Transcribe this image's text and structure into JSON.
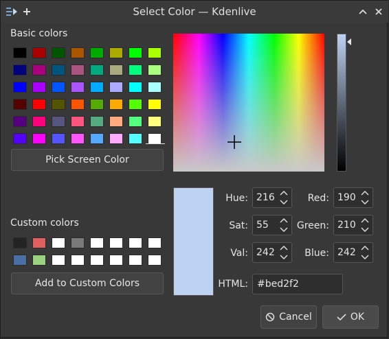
{
  "window": {
    "title": "Select Color — Kdenlive"
  },
  "titlebar_icons": {
    "app": "kdenlive-app-icon",
    "pin": "pin-icon",
    "maximize": "chevron-up-icon",
    "close": "close-icon"
  },
  "basic_colors": {
    "label": "Basic colors",
    "rows": [
      [
        "#000000",
        "#aa0000",
        "#005500",
        "#aa5500",
        "#00aa00",
        "#aaaa00",
        "#00ff00",
        "#aaff00"
      ],
      [
        "#00007f",
        "#aa007f",
        "#00557f",
        "#aa557f",
        "#00aa7f",
        "#aaaa7f",
        "#00ff7f",
        "#aaff7f"
      ],
      [
        "#0000ff",
        "#aa00ff",
        "#0055ff",
        "#aa55ff",
        "#00aaff",
        "#aaaaff",
        "#00ffff",
        "#aaffff"
      ],
      [
        "#550000",
        "#ff0000",
        "#555500",
        "#ff5500",
        "#55aa00",
        "#ffaa00",
        "#55ff00",
        "#ffff00"
      ],
      [
        "#55007f",
        "#ff007f",
        "#55557f",
        "#ff557f",
        "#55aa7f",
        "#ffaa7f",
        "#55ff7f",
        "#ffff7f"
      ],
      [
        "#5500ff",
        "#ff00ff",
        "#5555ff",
        "#ff55ff",
        "#55aaff",
        "#ffaaff",
        "#55ffff",
        "#ffffff"
      ]
    ]
  },
  "pick_screen_button": {
    "label": "Pick Screen Color"
  },
  "custom_colors": {
    "label": "Custom colors",
    "rows": [
      [
        "#232323",
        "#e06060",
        "#ffffff",
        "#7a7a7a",
        "#ffffff",
        "#ffffff",
        "#ffffff",
        "#ffffff"
      ],
      [
        "#4a6fa5",
        "#9bd27f",
        "#ffffff",
        "#ffffff",
        "#ffffff",
        "#ffffff",
        "#ffffff",
        "#ffffff"
      ]
    ]
  },
  "add_custom_button": {
    "label": "Add to Custom Colors"
  },
  "current_color": "#bed2f2",
  "fields": {
    "hue": {
      "label": "Hue:",
      "value": "216"
    },
    "sat": {
      "label": "Sat:",
      "value": "55"
    },
    "val": {
      "label": "Val:",
      "value": "242"
    },
    "red": {
      "label": "Red:",
      "value": "190"
    },
    "green": {
      "label": "Green:",
      "value": "210"
    },
    "blue": {
      "label": "Blue:",
      "value": "242"
    },
    "html": {
      "label": "HTML:",
      "value": "#bed2f2"
    }
  },
  "buttons": {
    "cancel": "Cancel",
    "ok": "OK"
  },
  "colors": {
    "background": "#383838",
    "titlebar": "#3a3a3a",
    "button": "#424242"
  }
}
